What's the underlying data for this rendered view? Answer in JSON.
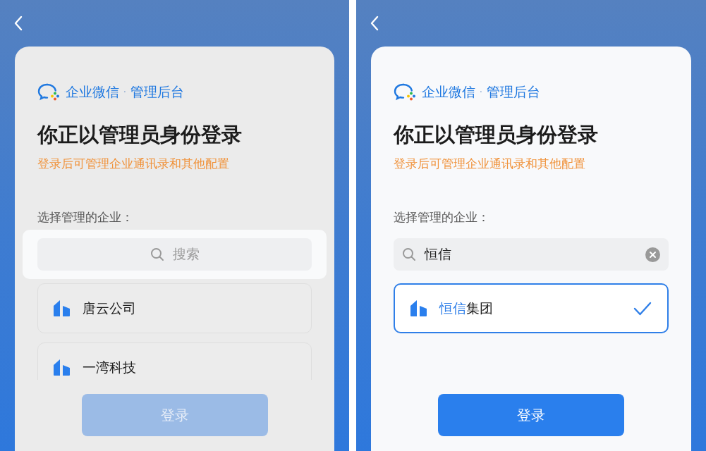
{
  "screens": [
    {
      "dimmed": true,
      "brand": {
        "name": "企业微信",
        "separator": "·",
        "product": "管理后台"
      },
      "title": "你正以管理员身份登录",
      "subtitle": "登录后可管理企业通讯录和其他配置",
      "label": "选择管理的企业：",
      "search": {
        "placeholder": "搜索"
      },
      "companies": [
        {
          "name": "唐云公司",
          "selected": false
        },
        {
          "name": "一湾科技",
          "selected": false
        }
      ],
      "login": {
        "label": "登录",
        "disabled": true
      }
    },
    {
      "dimmed": false,
      "brand": {
        "name": "企业微信",
        "separator": "·",
        "product": "管理后台"
      },
      "title": "你正以管理员身份登录",
      "subtitle": "登录后可管理企业通讯录和其他配置",
      "label": "选择管理的企业：",
      "search": {
        "value": "恒信"
      },
      "companies": [
        {
          "highlight": "恒信",
          "name": "集团",
          "selected": true
        }
      ],
      "login": {
        "label": "登录",
        "disabled": false
      }
    }
  ]
}
